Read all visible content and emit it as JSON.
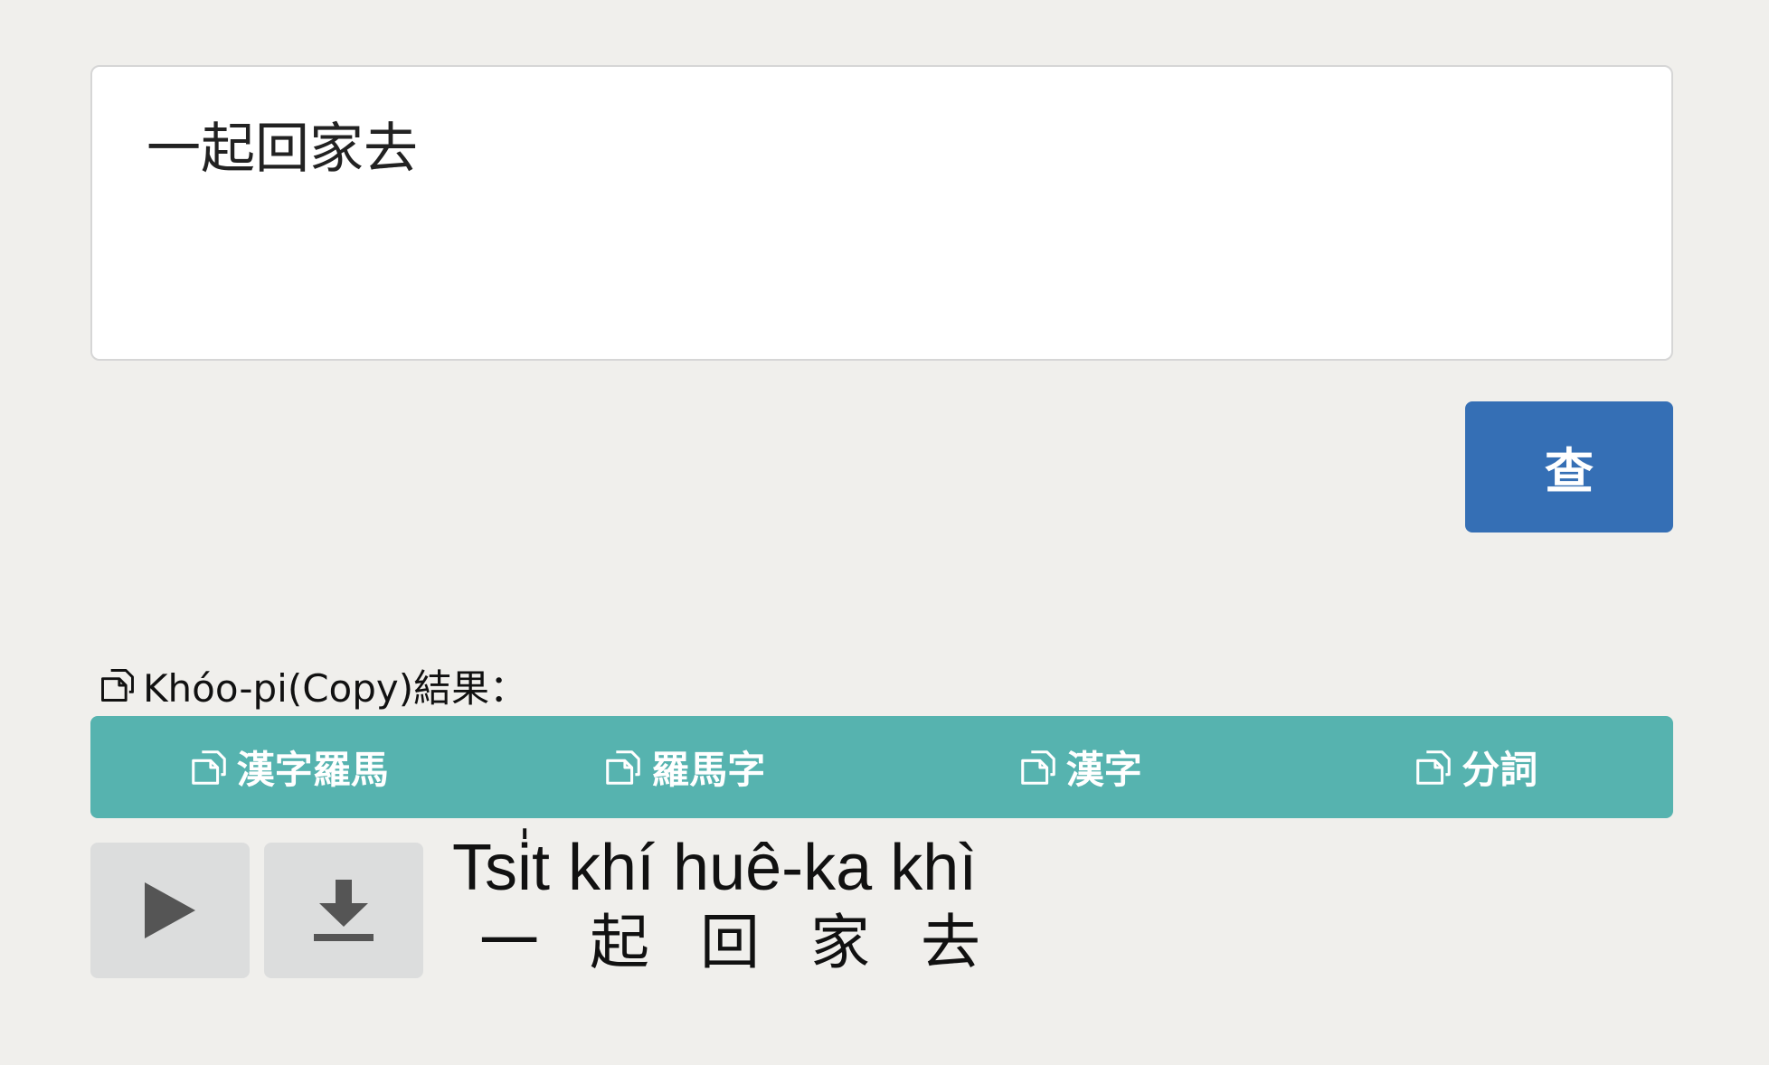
{
  "query": {
    "value": "一起回家去"
  },
  "submit": {
    "label": "查"
  },
  "copy_section": {
    "label": "Khóo-pi(Copy)結果：",
    "icon": "copy-icon",
    "buttons": [
      {
        "label": "漢字羅馬",
        "icon": "copy-icon"
      },
      {
        "label": "羅馬字",
        "icon": "copy-icon"
      },
      {
        "label": "漢字",
        "icon": "copy-icon"
      },
      {
        "label": "分詞",
        "icon": "copy-icon"
      }
    ]
  },
  "media": {
    "play_icon": "play-icon",
    "download_icon": "download-icon"
  },
  "result": {
    "romanization": "Tsi̍t khí huê-ka khì",
    "hanji": [
      "一",
      "起",
      "回",
      "家",
      "去"
    ]
  },
  "colors": {
    "background": "#f0efec",
    "submit_button": "#356fb5",
    "copy_bar": "#56b3af",
    "media_button": "#dcdddd"
  }
}
